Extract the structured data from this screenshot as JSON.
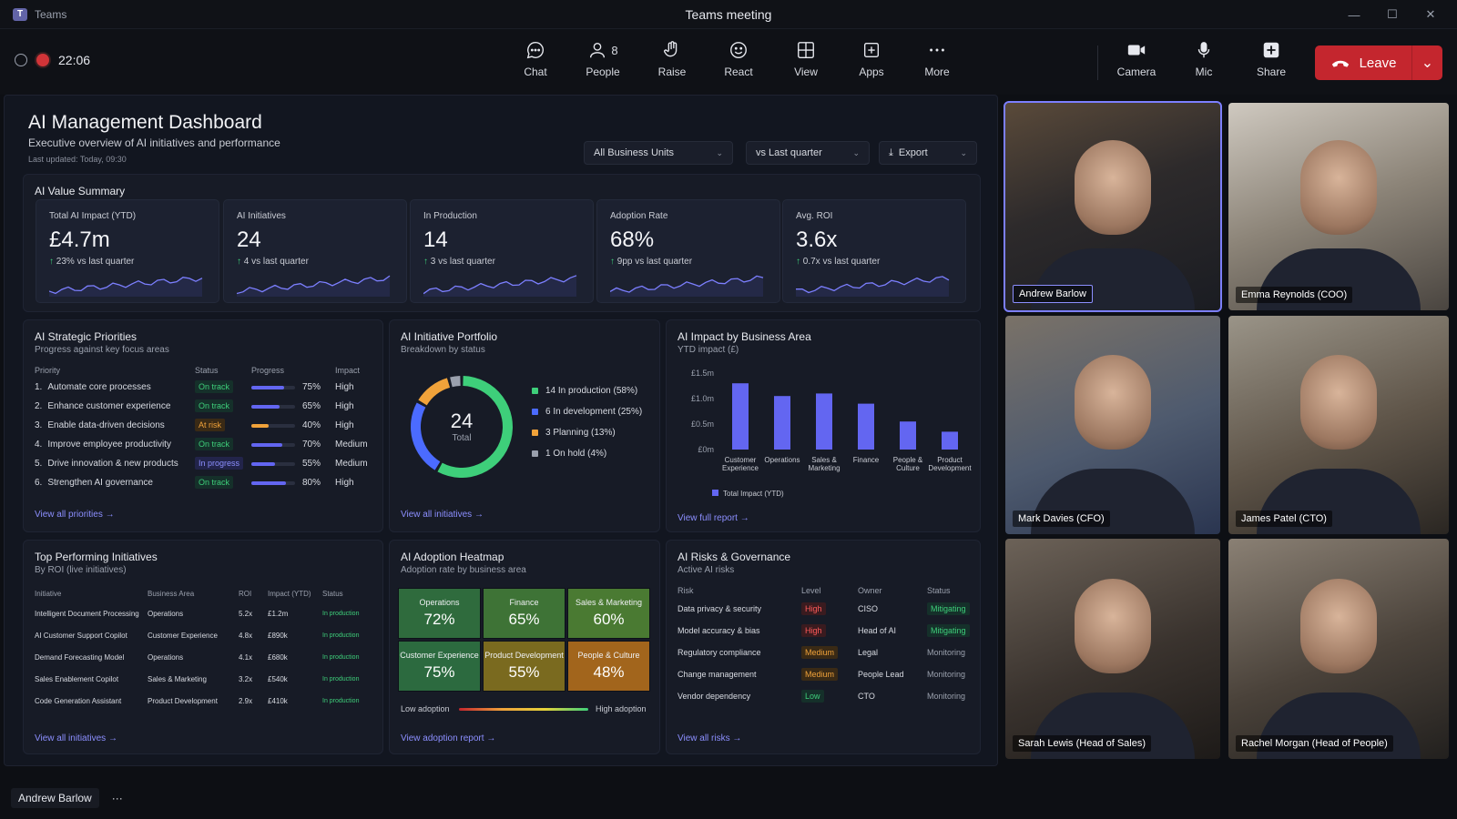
{
  "window": {
    "app_name": "Teams",
    "title": "Teams meeting",
    "min": "—",
    "max": "☐",
    "close": "✕"
  },
  "toolbar": {
    "timer": "22:06",
    "chat": "Chat",
    "people": "People",
    "people_count": "8",
    "raise": "Raise",
    "react": "React",
    "view": "View",
    "apps": "Apps",
    "more": "More",
    "camera": "Camera",
    "mic": "Mic",
    "share": "Share",
    "leave": "Leave"
  },
  "dashboard": {
    "title": "AI Management Dashboard",
    "subtitle": "Executive overview of AI initiatives and performance",
    "updated": "Last updated: Today, 09:30",
    "filters": {
      "units": "All Business Units",
      "compare": "vs Last quarter",
      "export": "Export"
    },
    "summary_title": "AI Value Summary",
    "kpis": [
      {
        "label": "Total AI Impact (YTD)",
        "value": "£4.7m",
        "delta": "23%",
        "delta_text": "vs last quarter"
      },
      {
        "label": "AI Initiatives",
        "value": "24",
        "delta": "4",
        "delta_text": "vs last quarter"
      },
      {
        "label": "In Production",
        "value": "14",
        "delta": "3",
        "delta_text": "vs last quarter"
      },
      {
        "label": "Adoption Rate",
        "value": "68%",
        "delta": "9pp",
        "delta_text": "vs last quarter"
      },
      {
        "label": "Avg. ROI",
        "value": "3.6x",
        "delta": "0.7x",
        "delta_text": "vs last quarter"
      }
    ],
    "priorities": {
      "title": "AI Strategic Priorities",
      "subtitle": "Progress against key focus areas",
      "headers": {
        "priority": "Priority",
        "status": "Status",
        "progress": "Progress",
        "impact": "Impact"
      },
      "rows": [
        {
          "num": "1.",
          "name": "Automate core processes",
          "status": "On track",
          "tone": "green",
          "progress": 75,
          "progress_label": "75%",
          "impact": "High"
        },
        {
          "num": "2.",
          "name": "Enhance customer experience",
          "status": "On track",
          "tone": "green",
          "progress": 65,
          "progress_label": "65%",
          "impact": "High"
        },
        {
          "num": "3.",
          "name": "Enable data-driven decisions",
          "status": "At risk",
          "tone": "amber",
          "progress": 40,
          "progress_label": "40%",
          "impact": "High"
        },
        {
          "num": "4.",
          "name": "Improve employee productivity",
          "status": "On track",
          "tone": "green",
          "progress": 70,
          "progress_label": "70%",
          "impact": "Medium"
        },
        {
          "num": "5.",
          "name": "Drive innovation & new products",
          "status": "In progress",
          "tone": "blue",
          "progress": 55,
          "progress_label": "55%",
          "impact": "Medium"
        },
        {
          "num": "6.",
          "name": "Strengthen AI governance",
          "status": "On track",
          "tone": "green",
          "progress": 80,
          "progress_label": "80%",
          "impact": "High"
        }
      ],
      "link": "View all priorities"
    },
    "portfolio": {
      "title": "AI Initiative Portfolio",
      "subtitle": "Breakdown by status",
      "total": "24",
      "total_label": "Total",
      "link": "View all initiatives"
    },
    "impact": {
      "title": "AI Impact by Business Area",
      "subtitle": "YTD impact (£)",
      "link": "View full report"
    },
    "top": {
      "title": "Top Performing Initiatives",
      "subtitle": "By ROI (live initiatives)",
      "headers": {
        "initiative": "Initiative",
        "area": "Business Area",
        "roi": "ROI",
        "impact": "Impact (YTD)",
        "status": "Status"
      },
      "rows": [
        {
          "name": "Intelligent Document Processing",
          "area": "Operations",
          "roi": "5.2x",
          "impact": "£1.2m",
          "status": "In production"
        },
        {
          "name": "AI Customer Support Copilot",
          "area": "Customer Experience",
          "roi": "4.8x",
          "impact": "£890k",
          "status": "In production"
        },
        {
          "name": "Demand Forecasting Model",
          "area": "Operations",
          "roi": "4.1x",
          "impact": "£680k",
          "status": "In production"
        },
        {
          "name": "Sales Enablement Copilot",
          "area": "Sales & Marketing",
          "roi": "3.2x",
          "impact": "£540k",
          "status": "In production"
        },
        {
          "name": "Code Generation Assistant",
          "area": "Product Development",
          "roi": "2.9x",
          "impact": "£410k",
          "status": "In production"
        }
      ],
      "link": "View all initiatives"
    },
    "heatmap": {
      "title": "AI Adoption Heatmap",
      "subtitle": "Adoption rate by business area",
      "cells": [
        {
          "label": "Operations",
          "value": "72%",
          "color": "#2f6b3d"
        },
        {
          "label": "Finance",
          "value": "65%",
          "color": "#3e7336"
        },
        {
          "label": "Sales & Marketing",
          "value": "60%",
          "color": "#4a7a32"
        },
        {
          "label": "Customer Experience",
          "value": "75%",
          "color": "#2c6a3f"
        },
        {
          "label": "Product Development",
          "value": "55%",
          "color": "#7a6a1f"
        },
        {
          "label": "People & Culture",
          "value": "48%",
          "color": "#a2651c"
        }
      ],
      "low": "Low adoption",
      "high": "High adoption",
      "link": "View adoption report"
    },
    "risks": {
      "title": "AI Risks & Governance",
      "subtitle": "Active AI risks",
      "headers": {
        "risk": "Risk",
        "level": "Level",
        "owner": "Owner",
        "status": "Status"
      },
      "rows": [
        {
          "name": "Data privacy & security",
          "level": "High",
          "tone": "red",
          "owner": "CISO",
          "status": "Mitigating",
          "status_tone": "green"
        },
        {
          "name": "Model accuracy & bias",
          "level": "High",
          "tone": "red",
          "owner": "Head of AI",
          "status": "Mitigating",
          "status_tone": "green"
        },
        {
          "name": "Regulatory compliance",
          "level": "Medium",
          "tone": "amber",
          "owner": "Legal",
          "status": "Monitoring",
          "status_tone": "plain"
        },
        {
          "name": "Change management",
          "level": "Medium",
          "tone": "amber",
          "owner": "People Lead",
          "status": "Monitoring",
          "status_tone": "plain"
        },
        {
          "name": "Vendor dependency",
          "level": "Low",
          "tone": "green",
          "owner": "CTO",
          "status": "Monitoring",
          "status_tone": "plain"
        }
      ],
      "link": "View all risks"
    }
  },
  "chart_data": [
    {
      "type": "pie",
      "title": "AI Initiative Portfolio",
      "categories": [
        "In production",
        "In development",
        "Planning",
        "On hold"
      ],
      "values": [
        14,
        6,
        3,
        1
      ],
      "labels": [
        "14  In production (58%)",
        "6   In development (25%)",
        "3   Planning (13%)",
        "1   On hold (4%)"
      ],
      "colors": [
        "#3ecf7a",
        "#4b6bff",
        "#f0a23a",
        "#9aa0ad"
      ],
      "legend": "right"
    },
    {
      "type": "bar",
      "title": "AI Impact by Business Area",
      "categories": [
        "Customer Experience",
        "Operations",
        "Sales & Marketing",
        "Finance",
        "People & Culture",
        "Product Development"
      ],
      "category_lines": [
        [
          "Customer",
          "Experience"
        ],
        [
          "Operations"
        ],
        [
          "Sales &",
          "Marketing"
        ],
        [
          "Finance"
        ],
        [
          "People &",
          "Culture"
        ],
        [
          "Product",
          "Development"
        ]
      ],
      "series": [
        {
          "name": "Total Impact (YTD)",
          "values": [
            1.3,
            1.05,
            1.1,
            0.9,
            0.55,
            0.35
          ]
        }
      ],
      "ylim": [
        0,
        1.5
      ],
      "yticks": [
        {
          "v": 0,
          "label": "£0m"
        },
        {
          "v": 0.5,
          "label": "£0.5m"
        },
        {
          "v": 1.0,
          "label": "£1.0m"
        },
        {
          "v": 1.5,
          "label": "£1.5m"
        }
      ],
      "color": "#6366f1",
      "legend": "bottom",
      "grid": false
    }
  ],
  "participants": [
    {
      "name": "Andrew Barlow",
      "active": true
    },
    {
      "name": "Emma Reynolds (COO)"
    },
    {
      "name": "Mark Davies (CFO)"
    },
    {
      "name": "James Patel (CTO)"
    },
    {
      "name": "Sarah Lewis (Head of Sales)"
    },
    {
      "name": "Rachel Morgan (Head of People)"
    }
  ],
  "presenter": {
    "name": "Andrew Barlow",
    "more": "···"
  }
}
